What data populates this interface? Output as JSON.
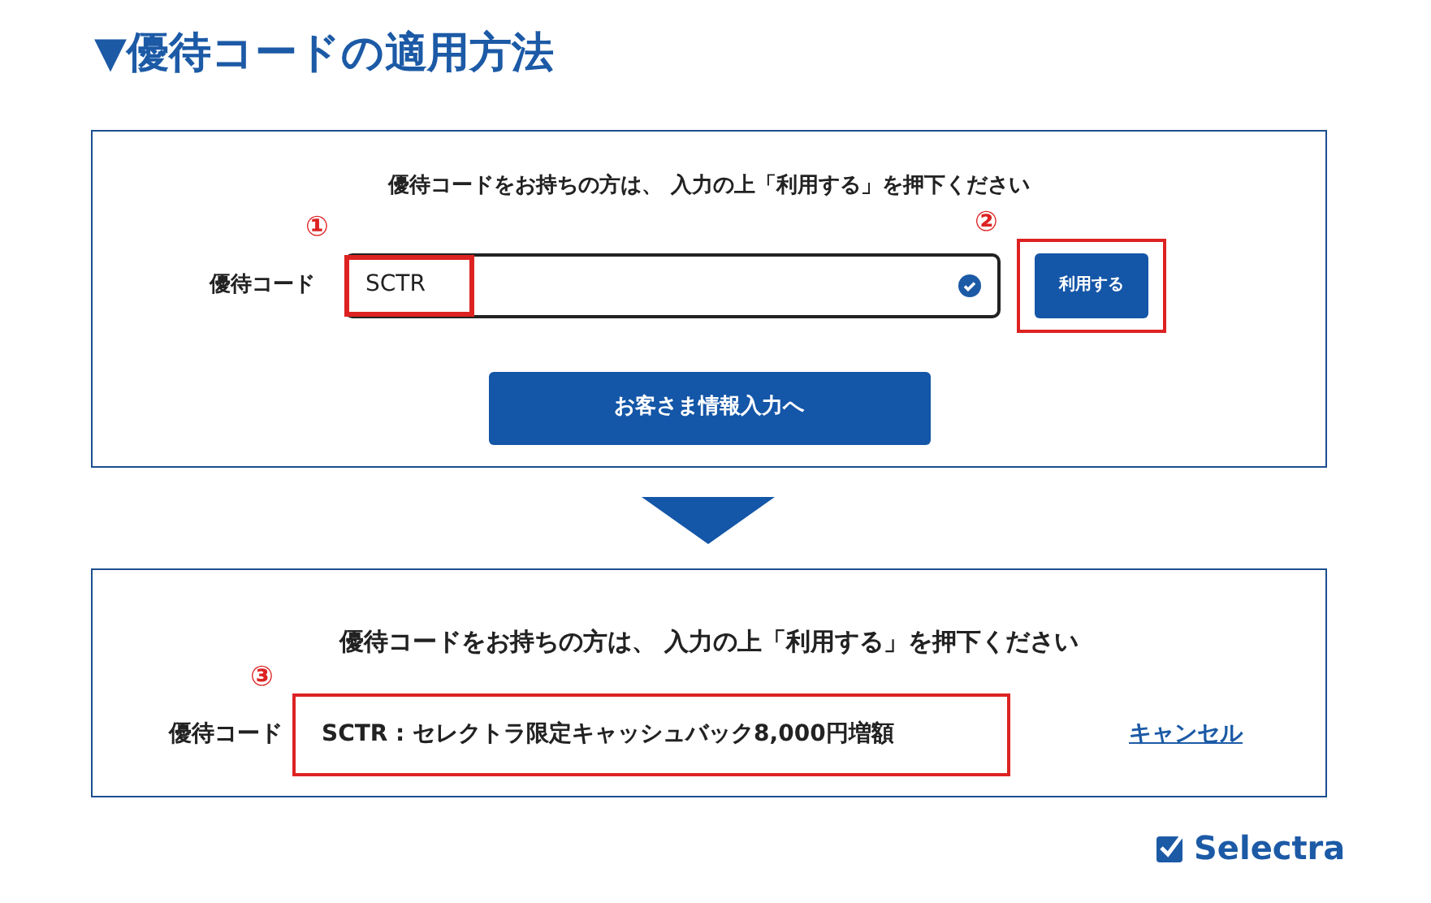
{
  "title": "▼優待コードの適用方法",
  "before": {
    "instruction": "優待コードをお持ちの方は、 入力の上「利用する」を押下ください",
    "field_label": "優待コード",
    "field_value": "SCTR",
    "field_marker": "①",
    "apply_button": "利用する",
    "apply_marker": "②",
    "next_button": "お客さま情報入力へ"
  },
  "after": {
    "instruction": "優待コードをお持ちの方は、 入力の上「利用する」を押下ください",
    "field_label": "優待コード",
    "applied_code": "SCTR : セレクトラ限定キャッシュバック8,000円増額",
    "applied_marker": "③",
    "cancel_link": "キャンセル"
  },
  "logo": "Selectra"
}
